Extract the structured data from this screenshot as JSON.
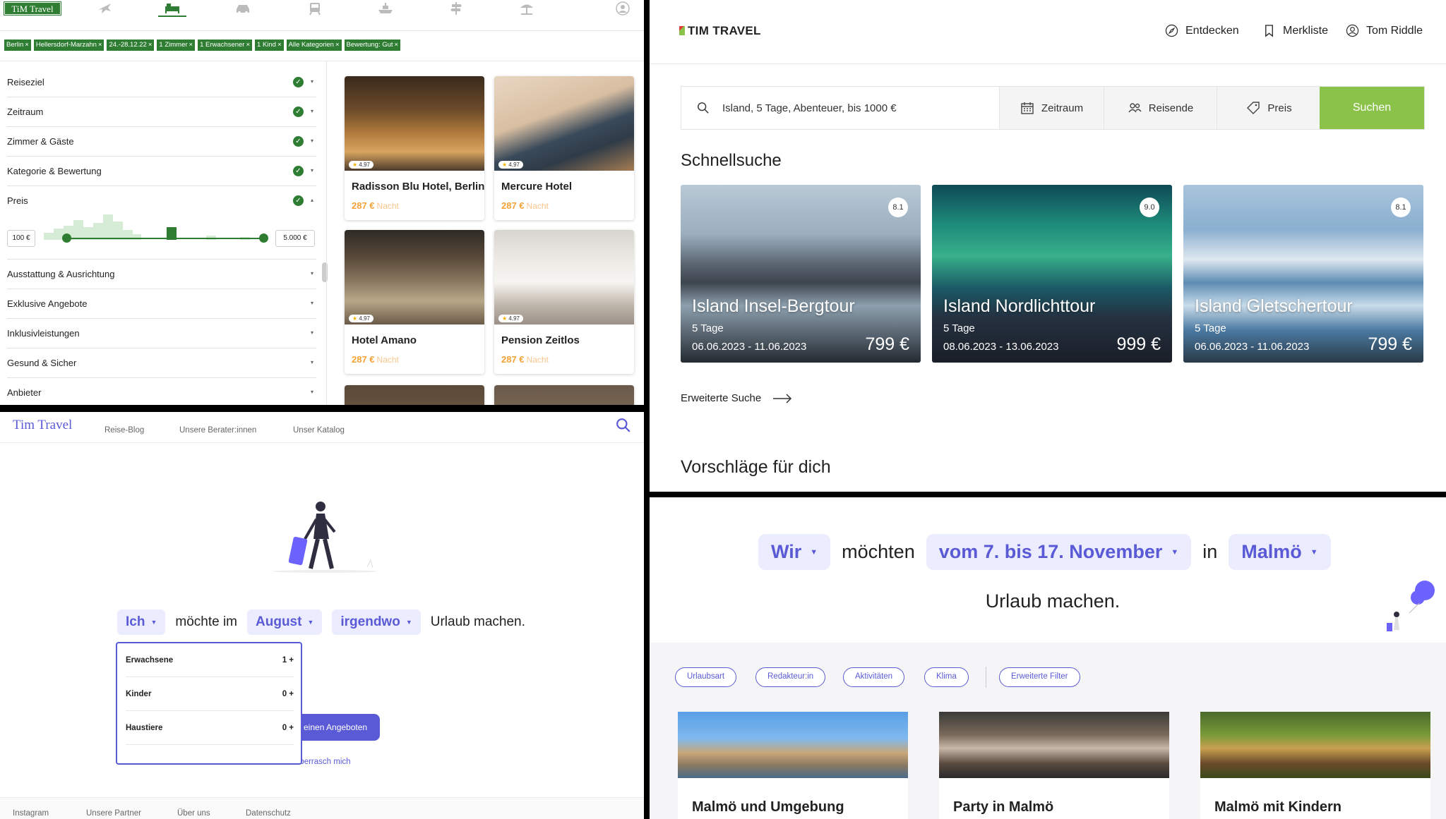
{
  "q1": {
    "logo": "TiM Travel",
    "chips": [
      "Berlin",
      "Hellersdorf-Marzahn",
      "24.-28.12.22",
      "1 Zimmer",
      "1 Erwachsener",
      "1 Kind",
      "Alle Kategorien",
      "Bewertung: Gut"
    ],
    "chip_close": "×",
    "filters_checked": [
      "Reiseziel",
      "Zeitraum",
      "Zimmer & Gäste",
      "Kategorie & Bewertung",
      "Preis"
    ],
    "price_min": "100 €",
    "price_max": "5.000 €",
    "filters_unchecked": [
      "Ausstattung & Ausrichtung",
      "Exklusive Angebote",
      "Inklusivleistungen",
      "Gesund & Sicher",
      "Anbieter"
    ],
    "hotels": [
      {
        "name": "Radisson Blu Hotel, Berlin",
        "rating": "4,97",
        "price": "287 €",
        "unit": "Nacht"
      },
      {
        "name": "Mercure Hotel",
        "rating": "4,97",
        "price": "287 €",
        "unit": "Nacht"
      },
      {
        "name": "Hotel Amano",
        "rating": "4,97",
        "price": "287 €",
        "unit": "Nacht"
      },
      {
        "name": "Pension Zeitlos",
        "rating": "4,97",
        "price": "287 €",
        "unit": "Nacht"
      }
    ],
    "colors": {
      "accent": "#2e7d32",
      "price": "#f4a235"
    }
  },
  "q2": {
    "logo": "TIM TRAVEL",
    "nav": [
      "Entdecken",
      "Merkliste",
      "Tom Riddle"
    ],
    "search_value": "Island, 5 Tage, Abenteuer, bis 1000 €",
    "segments": [
      "Zeitraum",
      "Reisende",
      "Preis"
    ],
    "search_button": "Suchen",
    "quick_heading": "Schnellsuche",
    "tours": [
      {
        "name": "Island Insel-Bergtour",
        "days": "5 Tage",
        "dates": "06.06.2023 - 11.06.2023",
        "price": "799 €",
        "rating": "8.1"
      },
      {
        "name": "Island Nordlichttour",
        "days": "5 Tage",
        "dates": "08.06.2023 - 13.06.2023",
        "price": "999 €",
        "rating": "9.0"
      },
      {
        "name": "Island Gletschertour",
        "days": "5 Tage",
        "dates": "06.06.2023 - 11.06.2023",
        "price": "799 €",
        "rating": "8.1"
      }
    ],
    "advanced": "Erweiterte Suche",
    "suggest_heading": "Vorschläge für dich",
    "colors": {
      "accent": "#8bc34a"
    }
  },
  "q3": {
    "logo": "Tim Travel",
    "nav": [
      "Reise-Blog",
      "Unsere Berater:innen",
      "Unser Katalog"
    ],
    "sentence": {
      "who": "Ich",
      "t1": "möchte im",
      "month": "August",
      "where": "irgendwo",
      "t2": "Urlaub machen."
    },
    "dropdown": [
      {
        "label": "Erwachsene",
        "value": "1 +"
      },
      {
        "label": "Kinder",
        "value": "0 +"
      },
      {
        "label": "Haustiere",
        "value": "0 +"
      }
    ],
    "button_partial": "einen Angeboten",
    "link": "Überrasch mich",
    "footer": [
      "Instagram",
      "Unsere Partner",
      "Über uns",
      "Datenschutz"
    ],
    "colors": {
      "accent": "#5a5ad6"
    }
  },
  "q4": {
    "sentence": {
      "who": "Wir",
      "t1": "möchten",
      "when": "vom 7. bis 17. November",
      "t2": "in",
      "where": "Malmö"
    },
    "line2": "Urlaub machen.",
    "filter_chips": [
      "Urlaubsart",
      "Redakteur:in",
      "Aktivitäten",
      "Klima"
    ],
    "advanced_filter": "Erweiterte Filter",
    "cards": [
      "Malmö und Umgebung",
      "Party in Malmö",
      "Malmö mit Kindern"
    ]
  }
}
